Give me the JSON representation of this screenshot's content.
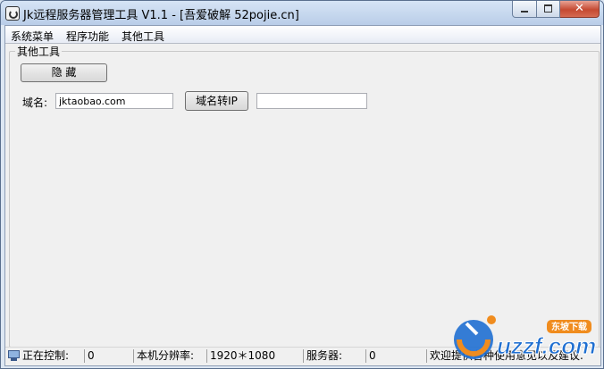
{
  "window": {
    "title": "Jk远程服务器管理工具 V1.1 - [吾爱破解 52pojie.cn]",
    "close_glyph": "✕"
  },
  "menu": {
    "items": [
      "系统菜单",
      "程序功能",
      "其他工具"
    ]
  },
  "group": {
    "title": "其他工具",
    "hide_button": "隐 藏",
    "domain_label": "域名:",
    "domain_value": "jktaobao.com",
    "convert_button": "域名转IP",
    "ip_value": ""
  },
  "status": {
    "controlling_label": "正在控制:",
    "controlling_value": "0",
    "resolution_label": "本机分辨率:",
    "resolution_value": "1920＊1080",
    "server_label": "服务器:",
    "server_value": "0",
    "message": "欢迎提供各种使用意见以及建议."
  },
  "watermark": {
    "brand": "uzzf.com",
    "tag": "东坡下载"
  },
  "colors": {
    "brand_blue": "#1f6fd1",
    "brand_orange": "#f08c1e",
    "close_red": "#c54a32"
  }
}
